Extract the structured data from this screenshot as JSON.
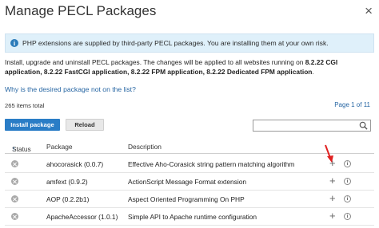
{
  "dialog": {
    "title": "Manage PECL Packages",
    "close_glyph": "×"
  },
  "alert": {
    "icon_glyph": "i",
    "text": "PHP extensions are supplied by third-party PECL packages. You are installing them at your own risk."
  },
  "description": {
    "part1": "Install, upgrade and uninstall PECL packages. The changes will be applied to all websites running on ",
    "bold1": "8.2.22 CGI application, 8.2.22 FastCGI application, 8.2.22 FPM application, 8.2.22 Dedicated FPM application",
    "part2": "."
  },
  "why_link": "Why is the desired package not on the list?",
  "total_items": "265 items total",
  "pagination": "Page 1 of 11",
  "toolbar": {
    "install_label": "Install package",
    "reload_label": "Reload"
  },
  "search": {
    "placeholder": "",
    "value": ""
  },
  "table": {
    "headers": {
      "status": "Status",
      "sort_indicator": "↑",
      "package": "Package",
      "description": "Description"
    },
    "rows": [
      {
        "package": "ahocorasick (0.0.7)",
        "description": "Effective Aho-Corasick string pattern matching algorithm"
      },
      {
        "package": "amfext (0.9.2)",
        "description": "ActionScript Message Format extension"
      },
      {
        "package": "AOP (0.2.2b1)",
        "description": "Aspect Oriented Programming On PHP"
      },
      {
        "package": "ApacheAccessor (1.0.1)",
        "description": "Simple API to Apache runtime configuration"
      }
    ],
    "action_add_glyph": "+",
    "action_info_glyph": "i"
  },
  "colors": {
    "accent": "#2a7dc6",
    "link": "#2766a3",
    "alert_bg": "#dff0fa",
    "annotation_arrow": "#e02020"
  }
}
